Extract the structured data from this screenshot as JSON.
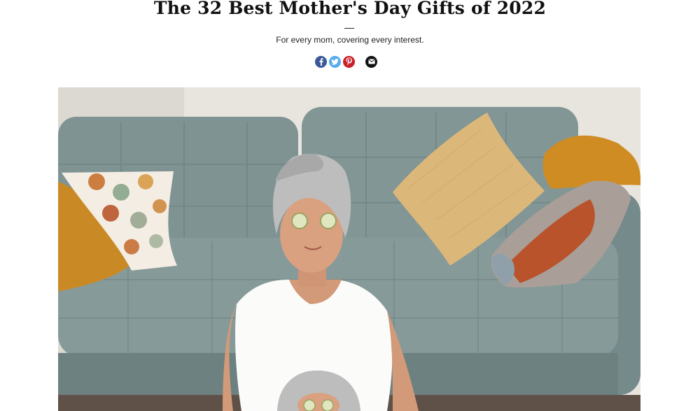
{
  "article": {
    "title": "The 32 Best Mother's Day Gifts of 2022",
    "subtitle": "For every mom, covering every interest."
  },
  "share": {
    "buttons": [
      {
        "network": "facebook",
        "icon": "facebook-icon",
        "color": "#3b5998"
      },
      {
        "network": "twitter",
        "icon": "twitter-icon",
        "color": "#55acee"
      },
      {
        "network": "pinterest",
        "icon": "pinterest-icon",
        "color": "#cb2027"
      },
      {
        "network": "email",
        "icon": "email-icon",
        "color": "#111111"
      }
    ]
  },
  "hero_image": {
    "icon": "photo-image",
    "colors": {
      "wall": "#e8e5df",
      "sofa": "#7d9191",
      "mustard": "#c98a26",
      "tan_pillow": "#dcb77a",
      "shirt": "#fbfbfa",
      "skin": "#d29a78",
      "towel": "#bdbdbd"
    }
  }
}
